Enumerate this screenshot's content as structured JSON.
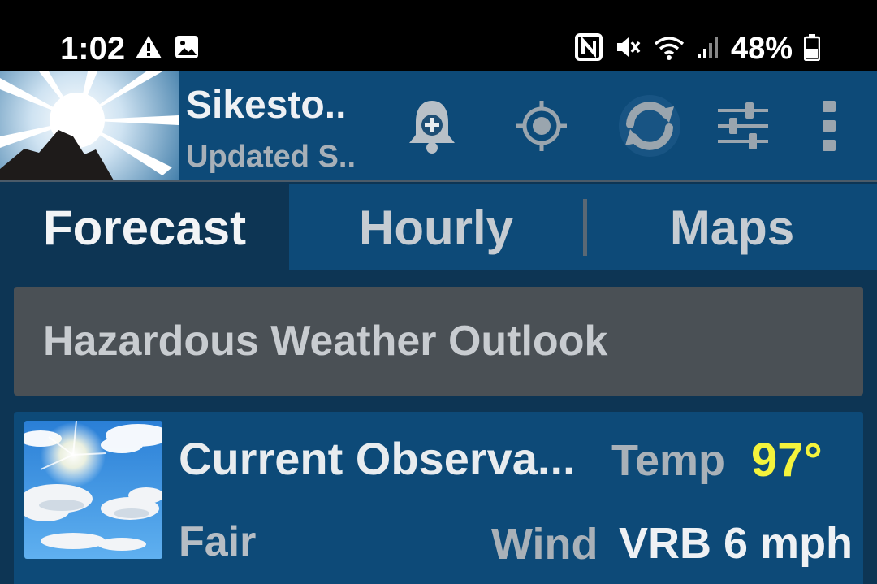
{
  "status_bar": {
    "time": "1:02",
    "battery_percent": "48%",
    "icons": [
      "warning-icon",
      "image-icon",
      "nfc-icon",
      "vibrate-icon",
      "wifi-icon",
      "signal-icon",
      "battery-icon"
    ]
  },
  "app_bar": {
    "location": "Sikesto..",
    "updated": "Updated S..",
    "actions": [
      "add-alert-icon",
      "locate-icon",
      "refresh-icon",
      "settings-sliders-icon",
      "overflow-menu-icon"
    ]
  },
  "tabs": [
    {
      "label": "Forecast",
      "active": true
    },
    {
      "label": "Hourly",
      "active": false
    },
    {
      "label": "Maps",
      "active": false
    }
  ],
  "hazard": {
    "label": "Hazardous Weather Outlook"
  },
  "observation": {
    "title": "Current Observa...",
    "condition": "Fair",
    "temp_label": "Temp",
    "temp_value": "97°",
    "wind_label": "Wind",
    "wind_value": "VRB 6 mph"
  },
  "colors": {
    "status_bg": "#000000",
    "app_bar_bg": "#0d4a78",
    "page_bg": "#0d3554",
    "hazard_bg": "#4a5055",
    "temp_accent": "#f4f33c"
  }
}
